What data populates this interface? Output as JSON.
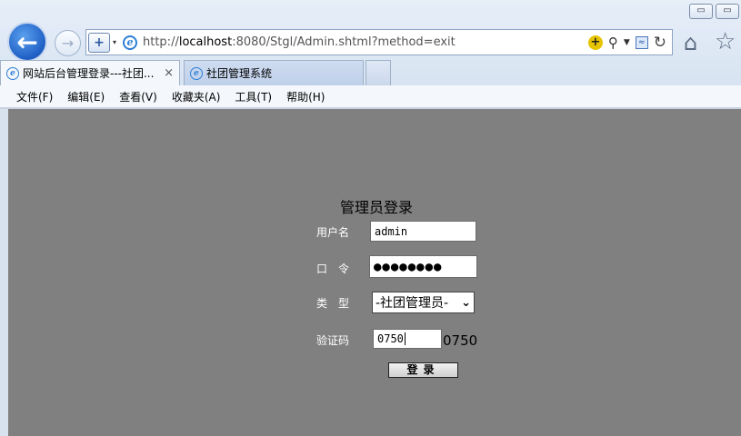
{
  "window": {
    "buttons": [
      "▭",
      "▭"
    ]
  },
  "browser": {
    "url_prefix": "http://",
    "url_host": "localhost",
    "url_rest": ":8080/Stgl/Admin.shtml?method=exit",
    "tabs": [
      {
        "label": "网站后台管理登录---社团...",
        "close": "×"
      },
      {
        "label": "社团管理系统"
      }
    ],
    "menu": [
      "文件(F)",
      "编辑(E)",
      "查看(V)",
      "收藏夹(A)",
      "工具(T)",
      "帮助(H)"
    ]
  },
  "login": {
    "title": "管理员登录",
    "username_label": "用户名",
    "username_value": "admin",
    "password_label": "口　令",
    "password_value": "●●●●●●●●",
    "type_label": "类　型",
    "type_value": "-社团管理员-",
    "code_label": "验证码",
    "code_value": "0750",
    "code_display": "0750",
    "submit_label": "登录"
  }
}
